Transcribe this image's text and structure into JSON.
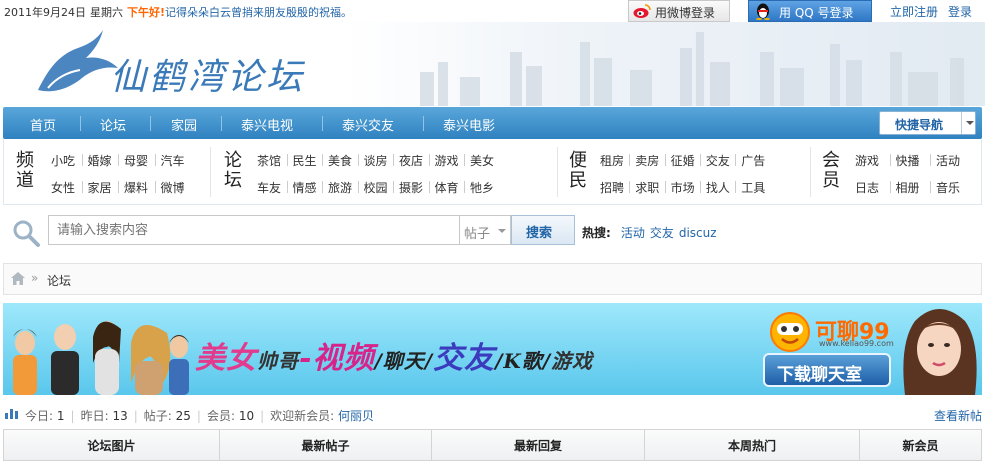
{
  "topbar": {
    "date": "2011年9月24日",
    "weekday": "星期六",
    "greeting_prefix": "下午好!",
    "greeting_text": "记得朵朵白云曾捎来朋友殷殷的祝福。",
    "weibo_login": "用微博登录",
    "qq_login": "用 QQ 号登录",
    "register": "立即注册",
    "login": "登录"
  },
  "header": {
    "logo_text": "仙鹤湾论坛"
  },
  "nav": {
    "items": [
      "首页",
      "论坛",
      "家园",
      "泰兴电视",
      "泰兴交友",
      "泰兴电影"
    ],
    "quick_nav": "快捷导航"
  },
  "categories": {
    "groups": [
      {
        "title": "频道",
        "row1": [
          "小吃",
          "婚嫁",
          "母婴",
          "汽车"
        ],
        "row2": [
          "女性",
          "家居",
          "爆料",
          "微博"
        ]
      },
      {
        "title": "论坛",
        "row1": [
          "茶馆",
          "民生",
          "美食",
          "谈房",
          "夜店",
          "游戏",
          "美女"
        ],
        "row2": [
          "车友",
          "情感",
          "旅游",
          "校园",
          "摄影",
          "体育",
          "牠乡"
        ]
      },
      {
        "title": "便民",
        "row1": [
          "租房",
          "卖房",
          "征婚",
          "交友",
          "广告"
        ],
        "row2": [
          "招聘",
          "求职",
          "市场",
          "找人",
          "工具"
        ]
      },
      {
        "title": "会员",
        "row1": [
          "游戏",
          "快播",
          "活动"
        ],
        "row2": [
          "日志",
          "相册",
          "音乐"
        ]
      }
    ]
  },
  "search": {
    "placeholder": "请输入搜索内容",
    "type": "帖子",
    "button": "搜索",
    "hot_label": "热搜:",
    "hot_terms": [
      "活动",
      "交友",
      "discuz"
    ]
  },
  "breadcrumb": {
    "current": "论坛"
  },
  "banner": {
    "slogan": [
      "美女",
      "帅哥",
      "-视频",
      "/聊天/",
      "交友",
      "/K歌/",
      "游戏"
    ],
    "brand": "可聊99",
    "brand_url": "www.keliao99.com",
    "download": "下载聊天室"
  },
  "stats": {
    "today_label": "今日:",
    "today": "1",
    "yesterday_label": "昨日:",
    "yesterday": "13",
    "posts_label": "帖子:",
    "posts": "25",
    "members_label": "会员:",
    "members": "10",
    "welcome_label": "欢迎新会员:",
    "new_member": "何丽贝",
    "view_new": "查看新帖"
  },
  "tabs": [
    "论坛图片",
    "最新帖子",
    "最新回复",
    "本周热门",
    "新会员"
  ],
  "colors": {
    "nav_blue": "#3a8ccb",
    "link_blue": "#2366a8",
    "banner_cyan": "#7dd8f5",
    "accent_orange": "#ff6600"
  }
}
